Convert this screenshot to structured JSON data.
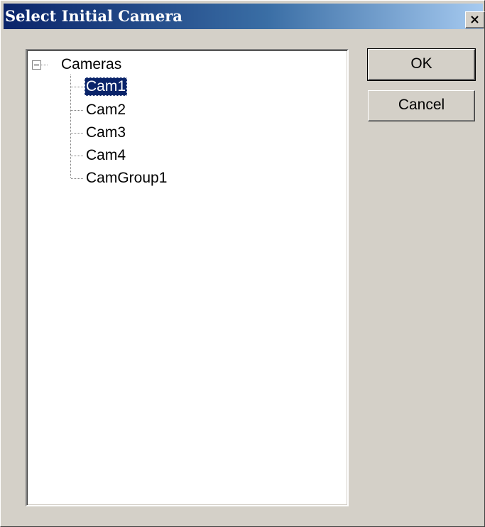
{
  "window": {
    "title": "Select Initial Camera"
  },
  "tree": {
    "root": {
      "label": "Cameras",
      "expanded": true,
      "toggle_glyph": "minus-box-icon"
    },
    "children": [
      {
        "label": "Cam1",
        "selected": true
      },
      {
        "label": "Cam2",
        "selected": false
      },
      {
        "label": "Cam3",
        "selected": false
      },
      {
        "label": "Cam4",
        "selected": false
      },
      {
        "label": "CamGroup1",
        "selected": false
      }
    ]
  },
  "buttons": {
    "ok_label": "OK",
    "cancel_label": "Cancel"
  },
  "colors": {
    "dialog_face": "#d4d0c8",
    "title_gradient_start": "#0a246a",
    "title_gradient_end": "#a6caf0",
    "selection": "#0a246a"
  }
}
